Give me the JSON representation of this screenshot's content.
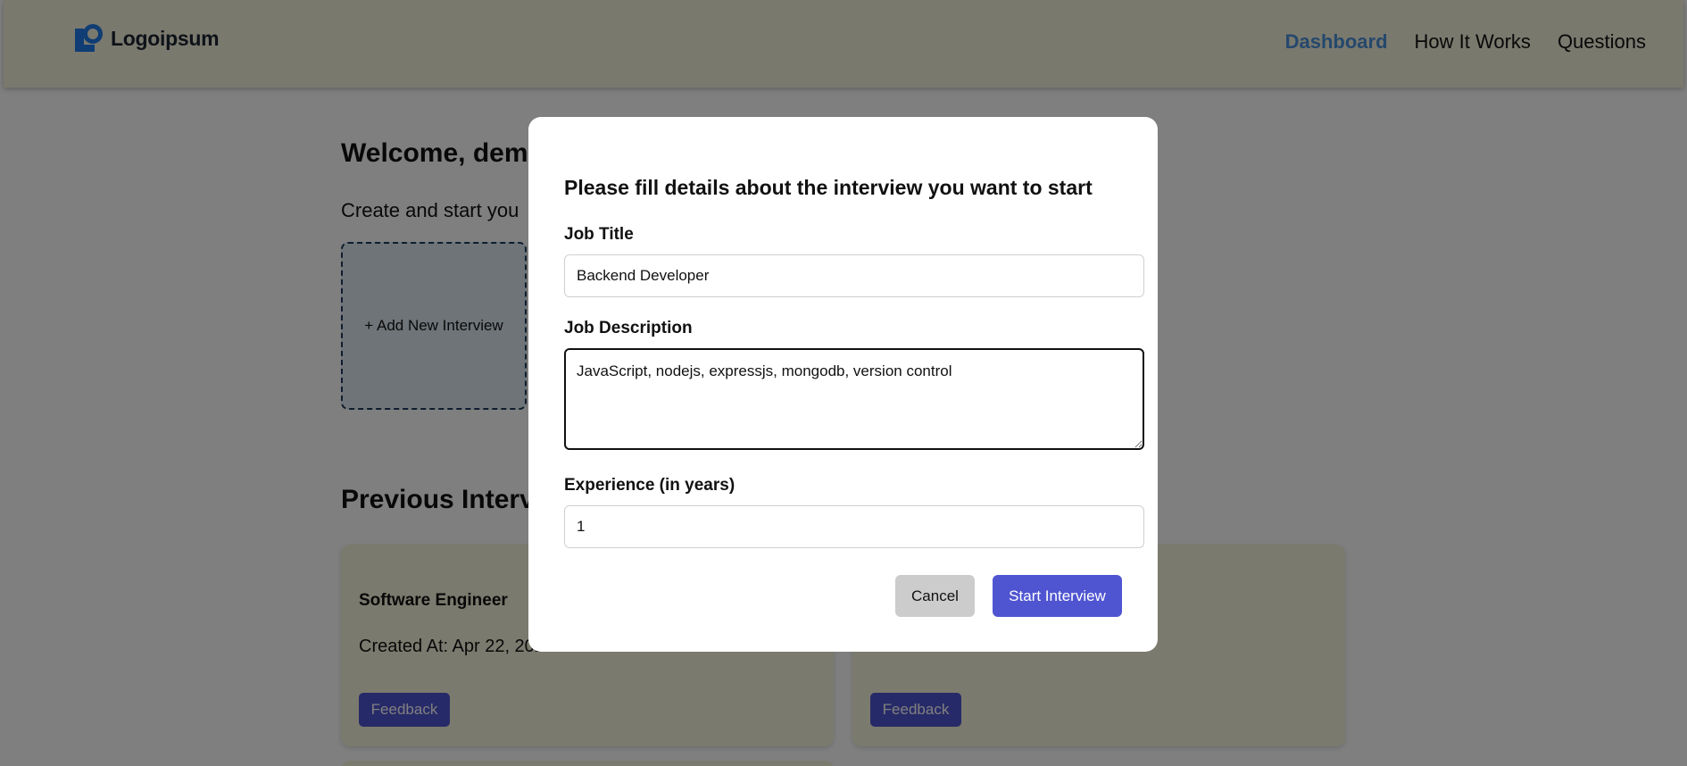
{
  "navbar": {
    "logo_text": "Logoipsum",
    "links": [
      {
        "label": "Dashboard",
        "active": true
      },
      {
        "label": "How It Works",
        "active": false
      },
      {
        "label": "Questions",
        "active": false
      }
    ]
  },
  "main": {
    "welcome": "Welcome, dem",
    "subtitle": "Create and start you",
    "add_card_label": "+ Add New Interview",
    "previous_title": "Previous Interv",
    "cards": [
      {
        "title": "Software Engineer",
        "created": "Created At: Apr 22, 202",
        "button": "Feedback"
      },
      {
        "title": "",
        "created": "",
        "button": "Feedback"
      }
    ]
  },
  "modal": {
    "title": "Please fill details about the interview you want to start",
    "job_title_label": "Job Title",
    "job_title_value": "Backend Developer",
    "job_description_label": "Job Description",
    "job_description_value": "JavaScript, nodejs, expressjs, mongodb, version control",
    "experience_label": "Experience (in years)",
    "experience_value": "1",
    "cancel_label": "Cancel",
    "start_label": "Start Interview"
  },
  "colors": {
    "navbar_bg": "#f4f2dc",
    "nav_active": "#4a90d9",
    "primary_button": "#4f55d1",
    "cancel_button": "#cccccc",
    "overlay": "rgba(0,0,0,0.5)"
  },
  "icons": {
    "logo": "logo-mark-icon"
  }
}
